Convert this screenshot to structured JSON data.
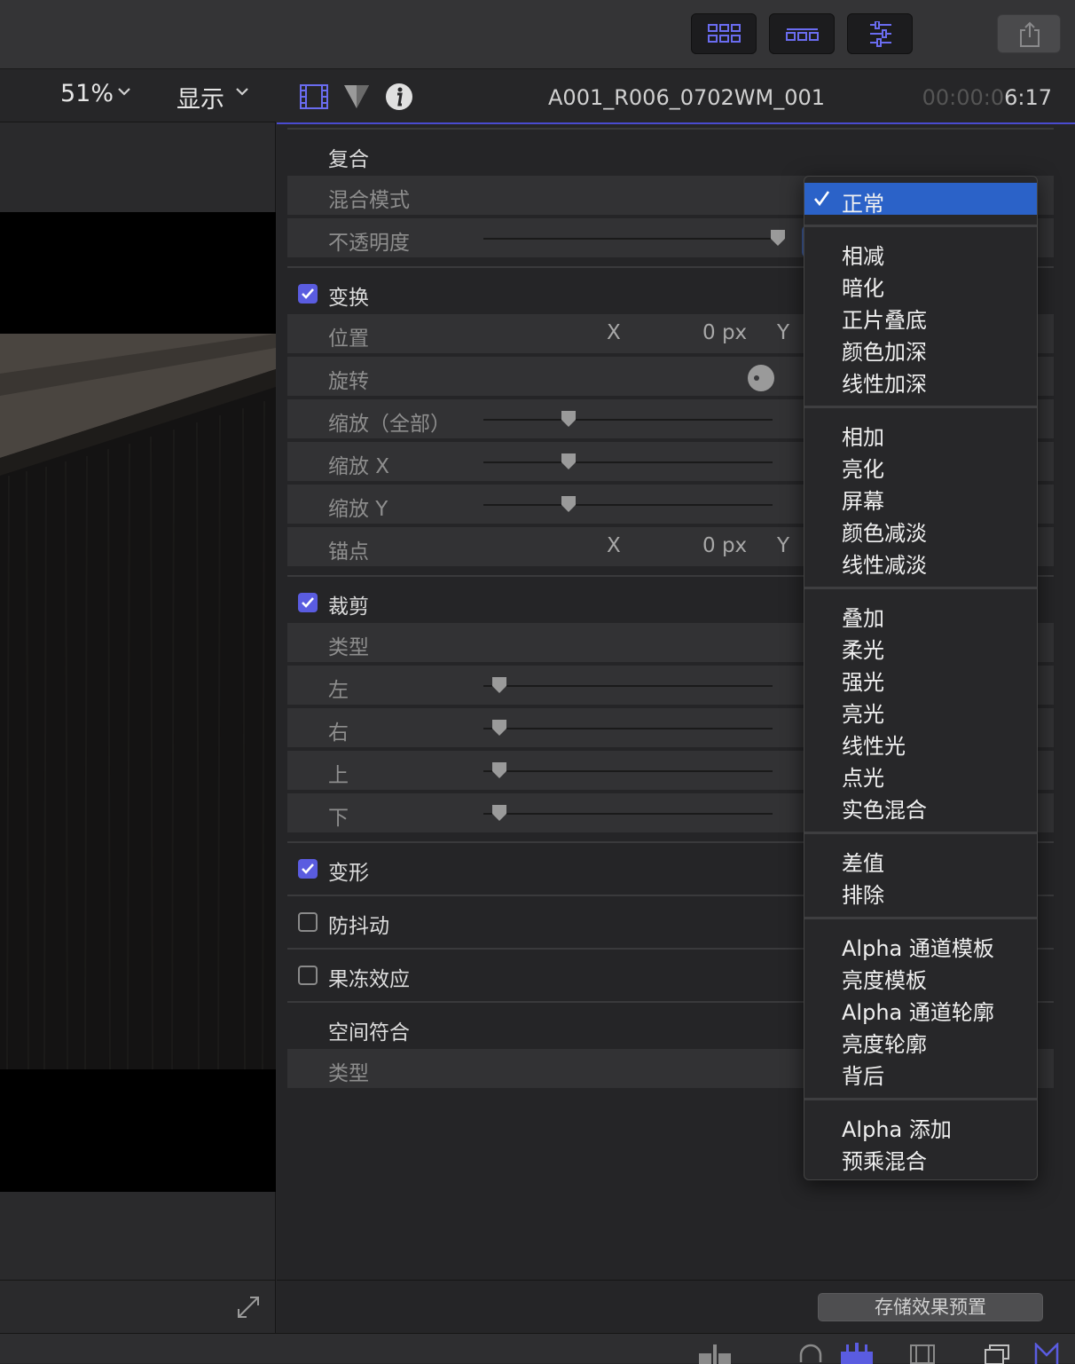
{
  "toolbar": {
    "buttons": [
      "browser-icon",
      "timeline-icon",
      "inspector-icon"
    ],
    "share_icon": "share-icon"
  },
  "viewer": {
    "zoom": "51%",
    "view_menu": "显示"
  },
  "inspector": {
    "tabs": [
      "video-tab-icon",
      "color-tab-icon",
      "info-tab-icon"
    ],
    "clip_name": "A001_R006_0702WM_001",
    "timecode_dim": "00:00:0",
    "timecode_bright": "6:17",
    "sections": {
      "compositing": {
        "label": "复合",
        "blend_mode": "混合模式",
        "opacity": "不透明度"
      },
      "transform": {
        "label": "变换",
        "position": "位置",
        "rotation": "旋转",
        "scale_all": "缩放（全部）",
        "scale_x": "缩放 X",
        "scale_y": "缩放 Y",
        "anchor": "锚点",
        "x": "X",
        "y": "Y",
        "px_value": "0 px"
      },
      "crop": {
        "label": "裁剪",
        "type": "类型",
        "left": "左",
        "right": "右",
        "top": "上",
        "bottom": "下"
      },
      "distort": {
        "label": "变形"
      },
      "stabilization": {
        "label": "防抖动"
      },
      "rolling_shutter": {
        "label": "果冻效应"
      },
      "spatial_conform": {
        "label": "空间符合",
        "type": "类型"
      }
    },
    "save_preset": "存储效果预置"
  },
  "blend_menu": {
    "selected": "正常",
    "groups": [
      [
        "相减",
        "暗化",
        "正片叠底",
        "颜色加深",
        "线性加深"
      ],
      [
        "相加",
        "亮化",
        "屏幕",
        "颜色减淡",
        "线性减淡"
      ],
      [
        "叠加",
        "柔光",
        "强光",
        "亮光",
        "线性光",
        "点光",
        "实色混合"
      ],
      [
        "差值",
        "排除"
      ],
      [
        "Alpha 通道模板",
        "亮度模板",
        "Alpha 通道轮廓",
        "亮度轮廓",
        "背后"
      ],
      [
        "Alpha 添加",
        "预乘混合"
      ]
    ]
  },
  "colors": {
    "accent": "#5a5ce0",
    "menu_selection": "#2b62c8"
  }
}
